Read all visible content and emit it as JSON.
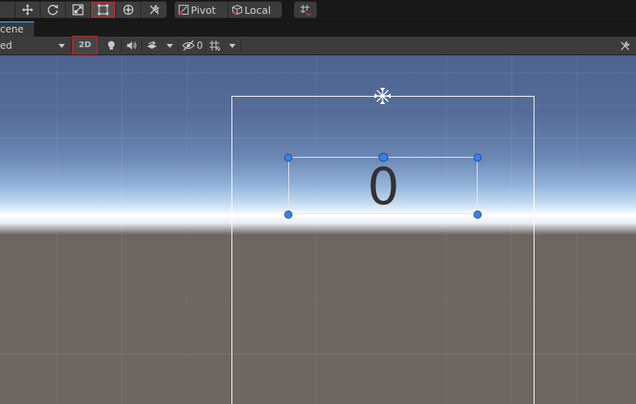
{
  "toolbar": {
    "tools": [
      {
        "name": "move-tool",
        "icon": "move-arrows-icon"
      },
      {
        "name": "rotate-tool",
        "icon": "rotate-icon"
      },
      {
        "name": "scale-tool",
        "icon": "scale-icon"
      },
      {
        "name": "rect-tool",
        "icon": "rect-transform-icon",
        "active": true
      },
      {
        "name": "transform-tool",
        "icon": "transform-icon"
      },
      {
        "name": "custom-tool",
        "icon": "custom-tools-icon"
      }
    ],
    "pivot_label": "Pivot",
    "local_label": "Local",
    "grid_snap_icon": "grid-snap-icon"
  },
  "tabs": {
    "scene_label": "cene"
  },
  "scene_toolbar": {
    "shading_mode": "ed",
    "mode_2d_label": "2D",
    "hidden_count": "0",
    "icons": [
      "lighting-icon",
      "audio-icon",
      "effects-icon",
      "visibility-icon",
      "grid-icon",
      "tools-icon"
    ]
  },
  "viewport": {
    "text_value": "0",
    "colors": {
      "sky_top": "#4e6390",
      "horizon": "#ffffff",
      "ground": "#6d6661",
      "handle": "#3a80e0",
      "selection_highlight": "#d21e1e"
    }
  }
}
